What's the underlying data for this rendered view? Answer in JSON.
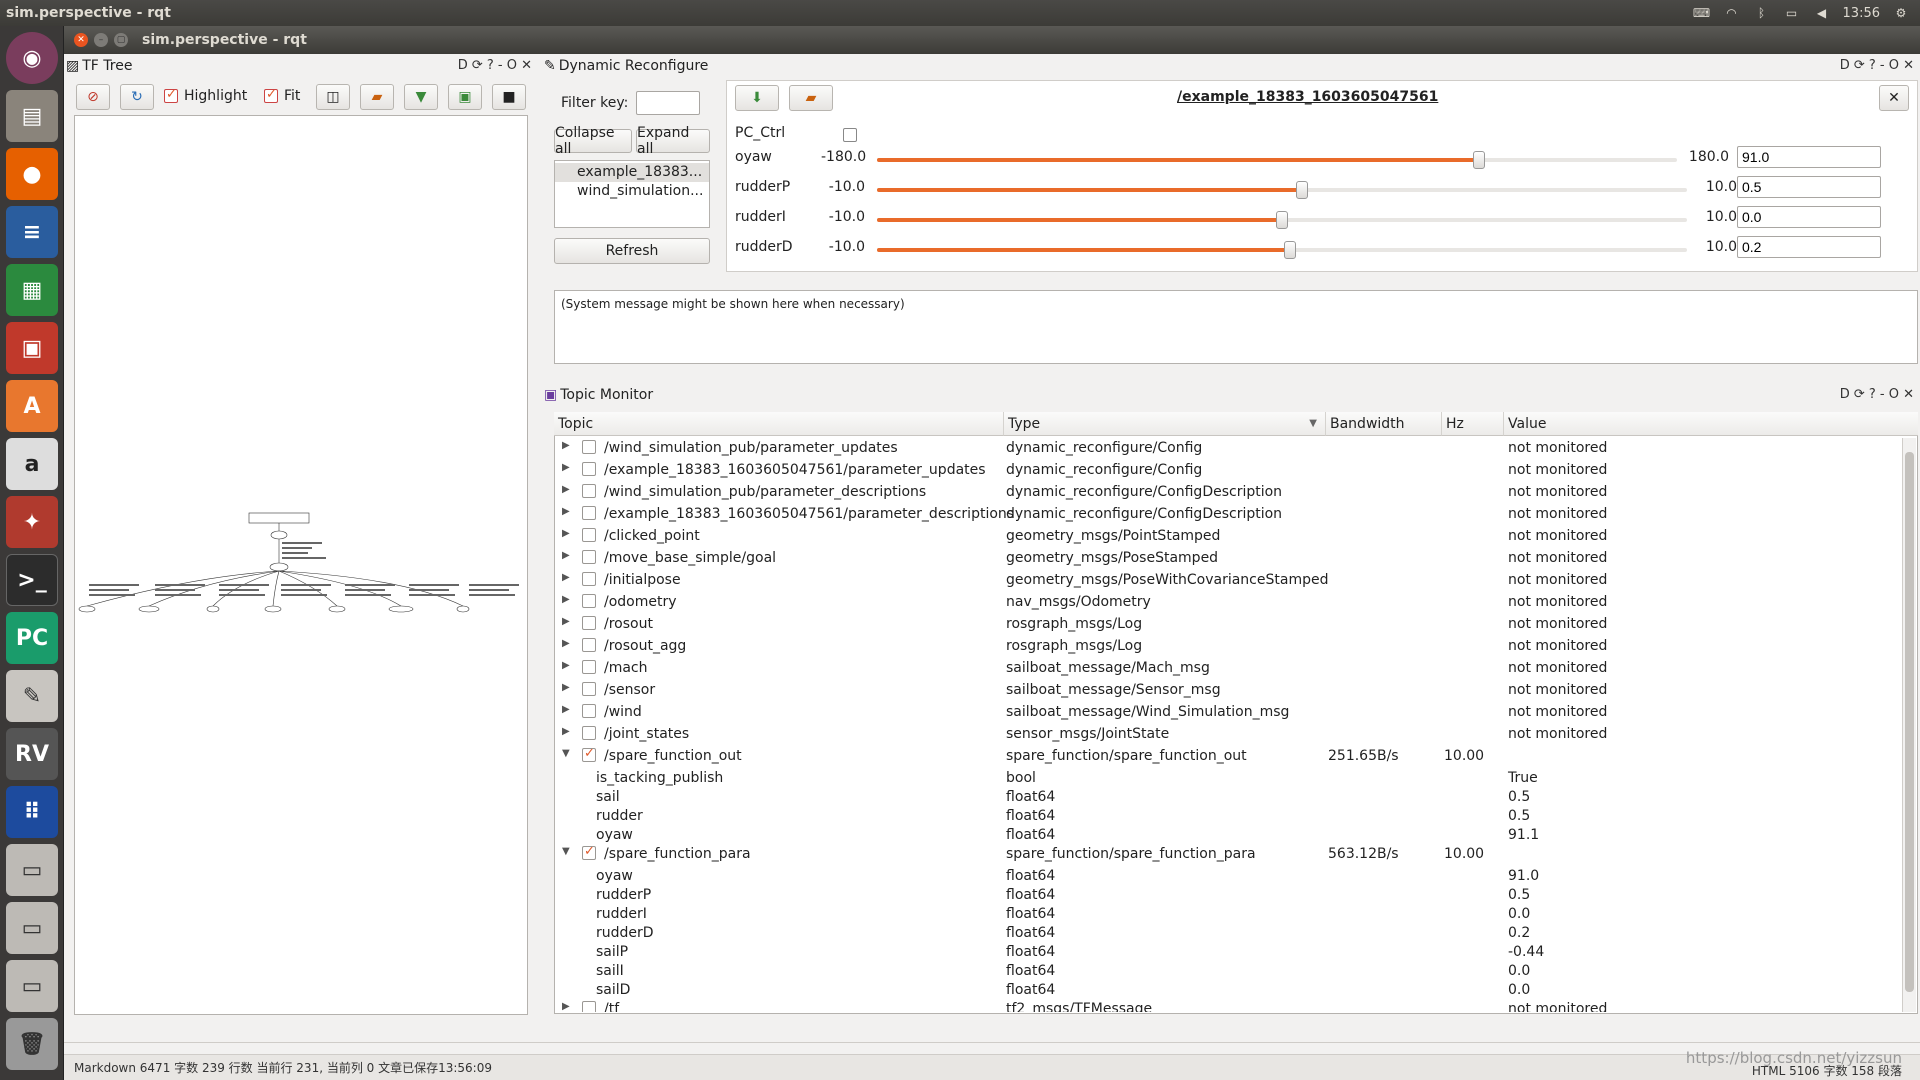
{
  "topbar": {
    "title": "sim.perspective - rqt",
    "time": "13:56"
  },
  "window": {
    "title": "sim.perspective - rqt"
  },
  "tf_tree": {
    "title": "TF Tree",
    "highlight_label": "Highlight",
    "fit_label": "Fit",
    "highlight_checked": true,
    "fit_checked": true
  },
  "dynamic_reconfigure": {
    "title": "Dynamic Reconfigure",
    "filter_label": "Filter key:",
    "collapse_label": "Collapse all",
    "expand_label": "Expand all",
    "nodes": [
      "example_18383...",
      "wind_simulation..."
    ],
    "refresh_label": "Refresh",
    "node_path": "/example_18383_1603605047561",
    "pc_ctrl_label": "PC_Ctrl",
    "params": [
      {
        "name": "oyaw",
        "min": "-180.0",
        "max": "180.0",
        "value": "91.0",
        "fraction": 0.7528
      },
      {
        "name": "rudderP",
        "min": "-10.0",
        "max": "10.0",
        "value": "0.5",
        "fraction": 0.525
      },
      {
        "name": "rudderI",
        "min": "-10.0",
        "max": "10.0",
        "value": "0.0",
        "fraction": 0.5
      },
      {
        "name": "rudderD",
        "min": "-10.0",
        "max": "10.0",
        "value": "0.2",
        "fraction": 0.51
      }
    ],
    "system_message": "(System message might be shown here when necessary)"
  },
  "topic_monitor": {
    "title": "Topic Monitor",
    "columns": {
      "topic": "Topic",
      "type": "Type",
      "bandwidth": "Bandwidth",
      "hz": "Hz",
      "value": "Value"
    },
    "rows": [
      {
        "kind": "topic",
        "expanded": false,
        "checked": false,
        "topic": "/wind_simulation_pub/parameter_updates",
        "type": "dynamic_reconfigure/Config",
        "bandwidth": "",
        "hz": "",
        "value": "not monitored"
      },
      {
        "kind": "topic",
        "expanded": false,
        "checked": false,
        "topic": "/example_18383_1603605047561/parameter_updates",
        "type": "dynamic_reconfigure/Config",
        "bandwidth": "",
        "hz": "",
        "value": "not monitored"
      },
      {
        "kind": "topic",
        "expanded": false,
        "checked": false,
        "topic": "/wind_simulation_pub/parameter_descriptions",
        "type": "dynamic_reconfigure/ConfigDescription",
        "bandwidth": "",
        "hz": "",
        "value": "not monitored"
      },
      {
        "kind": "topic",
        "expanded": false,
        "checked": false,
        "topic": "/example_18383_1603605047561/parameter_descriptions",
        "type": "dynamic_reconfigure/ConfigDescription",
        "bandwidth": "",
        "hz": "",
        "value": "not monitored"
      },
      {
        "kind": "topic",
        "expanded": false,
        "checked": false,
        "topic": "/clicked_point",
        "type": "geometry_msgs/PointStamped",
        "bandwidth": "",
        "hz": "",
        "value": "not monitored"
      },
      {
        "kind": "topic",
        "expanded": false,
        "checked": false,
        "topic": "/move_base_simple/goal",
        "type": "geometry_msgs/PoseStamped",
        "bandwidth": "",
        "hz": "",
        "value": "not monitored"
      },
      {
        "kind": "topic",
        "expanded": false,
        "checked": false,
        "topic": "/initialpose",
        "type": "geometry_msgs/PoseWithCovarianceStamped",
        "bandwidth": "",
        "hz": "",
        "value": "not monitored"
      },
      {
        "kind": "topic",
        "expanded": false,
        "checked": false,
        "topic": "/odometry",
        "type": "nav_msgs/Odometry",
        "bandwidth": "",
        "hz": "",
        "value": "not monitored"
      },
      {
        "kind": "topic",
        "expanded": false,
        "checked": false,
        "topic": "/rosout",
        "type": "rosgraph_msgs/Log",
        "bandwidth": "",
        "hz": "",
        "value": "not monitored"
      },
      {
        "kind": "topic",
        "expanded": false,
        "checked": false,
        "topic": "/rosout_agg",
        "type": "rosgraph_msgs/Log",
        "bandwidth": "",
        "hz": "",
        "value": "not monitored"
      },
      {
        "kind": "topic",
        "expanded": false,
        "checked": false,
        "topic": "/mach",
        "type": "sailboat_message/Mach_msg",
        "bandwidth": "",
        "hz": "",
        "value": "not monitored"
      },
      {
        "kind": "topic",
        "expanded": false,
        "checked": false,
        "topic": "/sensor",
        "type": "sailboat_message/Sensor_msg",
        "bandwidth": "",
        "hz": "",
        "value": "not monitored"
      },
      {
        "kind": "topic",
        "expanded": false,
        "checked": false,
        "topic": "/wind",
        "type": "sailboat_message/Wind_Simulation_msg",
        "bandwidth": "",
        "hz": "",
        "value": "not monitored"
      },
      {
        "kind": "topic",
        "expanded": false,
        "checked": false,
        "topic": "/joint_states",
        "type": "sensor_msgs/JointState",
        "bandwidth": "",
        "hz": "",
        "value": "not monitored"
      },
      {
        "kind": "topic",
        "expanded": true,
        "checked": true,
        "topic": "/spare_function_out",
        "type": "spare_function/spare_function_out",
        "bandwidth": "251.65B/s",
        "hz": "10.00",
        "value": ""
      },
      {
        "kind": "field",
        "topic": "is_tacking_publish",
        "type": "bool",
        "value": "True"
      },
      {
        "kind": "field",
        "topic": "sail",
        "type": "float64",
        "value": "0.5"
      },
      {
        "kind": "field",
        "topic": "rudder",
        "type": "float64",
        "value": "0.5"
      },
      {
        "kind": "field",
        "topic": "oyaw",
        "type": "float64",
        "value": "91.1"
      },
      {
        "kind": "topic",
        "expanded": true,
        "checked": true,
        "topic": "/spare_function_para",
        "type": "spare_function/spare_function_para",
        "bandwidth": "563.12B/s",
        "hz": "10.00",
        "value": ""
      },
      {
        "kind": "field",
        "topic": "oyaw",
        "type": "float64",
        "value": "91.0"
      },
      {
        "kind": "field",
        "topic": "rudderP",
        "type": "float64",
        "value": "0.5"
      },
      {
        "kind": "field",
        "topic": "rudderI",
        "type": "float64",
        "value": "0.0"
      },
      {
        "kind": "field",
        "topic": "rudderD",
        "type": "float64",
        "value": "0.2"
      },
      {
        "kind": "field",
        "topic": "sailP",
        "type": "float64",
        "value": "-0.44"
      },
      {
        "kind": "field",
        "topic": "sailI",
        "type": "float64",
        "value": "0.0"
      },
      {
        "kind": "field",
        "topic": "sailD",
        "type": "float64",
        "value": "0.0"
      },
      {
        "kind": "topic",
        "expanded": false,
        "checked": false,
        "topic": "/tf",
        "type": "tf2_msgs/TFMessage",
        "bandwidth": "",
        "hz": "",
        "value": "not monitored"
      }
    ]
  },
  "statusbar": {
    "left": "Markdown   6471 字数   239 行数   当前行 231, 当前列 0   文章已保存13:56:09",
    "right": "HTML   5106 字数   158 段落",
    "watermark": "https://blog.csdn.net/yizzsun"
  },
  "launcher": [
    "ubuntu-icon",
    "files-icon",
    "firefox-icon",
    "writer-icon",
    "calc-icon",
    "impress-icon",
    "software-center-icon",
    "amazon-icon",
    "settings-icon",
    "terminal-icon",
    "pycharm-icon",
    "text-editor-icon",
    "rviz-icon",
    "apps-icon",
    "drive-icon",
    "drive-icon",
    "drive-icon",
    "trash-icon"
  ]
}
